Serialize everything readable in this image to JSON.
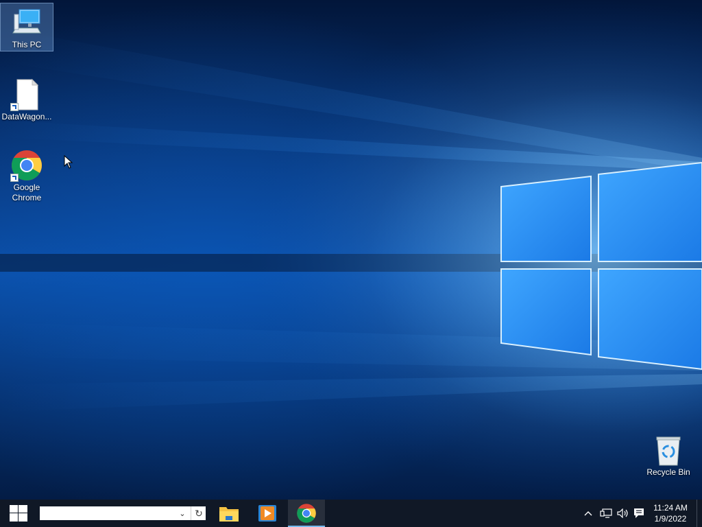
{
  "desktop": {
    "icons": [
      {
        "label": "This PC",
        "icon": "computer-icon",
        "selected": true
      },
      {
        "label": "DataWagon...",
        "icon": "blank-file-icon",
        "shortcut": true
      },
      {
        "label": "Google Chrome",
        "icon": "chrome-icon",
        "shortcut": true
      },
      {
        "label": "Recycle Bin",
        "icon": "recycle-bin-icon"
      }
    ]
  },
  "taskbar": {
    "start_icon": "windows-logo-icon",
    "search": {
      "value": "",
      "placeholder": ""
    },
    "apps": [
      {
        "name": "File Explorer",
        "icon": "file-explorer-icon",
        "active": false
      },
      {
        "name": "Media Player",
        "icon": "media-player-icon",
        "active": false
      },
      {
        "name": "Google Chrome",
        "icon": "chrome-icon",
        "active": true
      }
    ],
    "tray": {
      "icons": [
        "chevron-up-icon",
        "network-icon",
        "volume-icon",
        "notification-icon"
      ],
      "time": "11:24 AM",
      "date": "1/9/2022"
    }
  },
  "colors": {
    "taskbar": "#101826",
    "accent": "#76b9ed",
    "wallpaper_blue": "#0b4fa8"
  }
}
